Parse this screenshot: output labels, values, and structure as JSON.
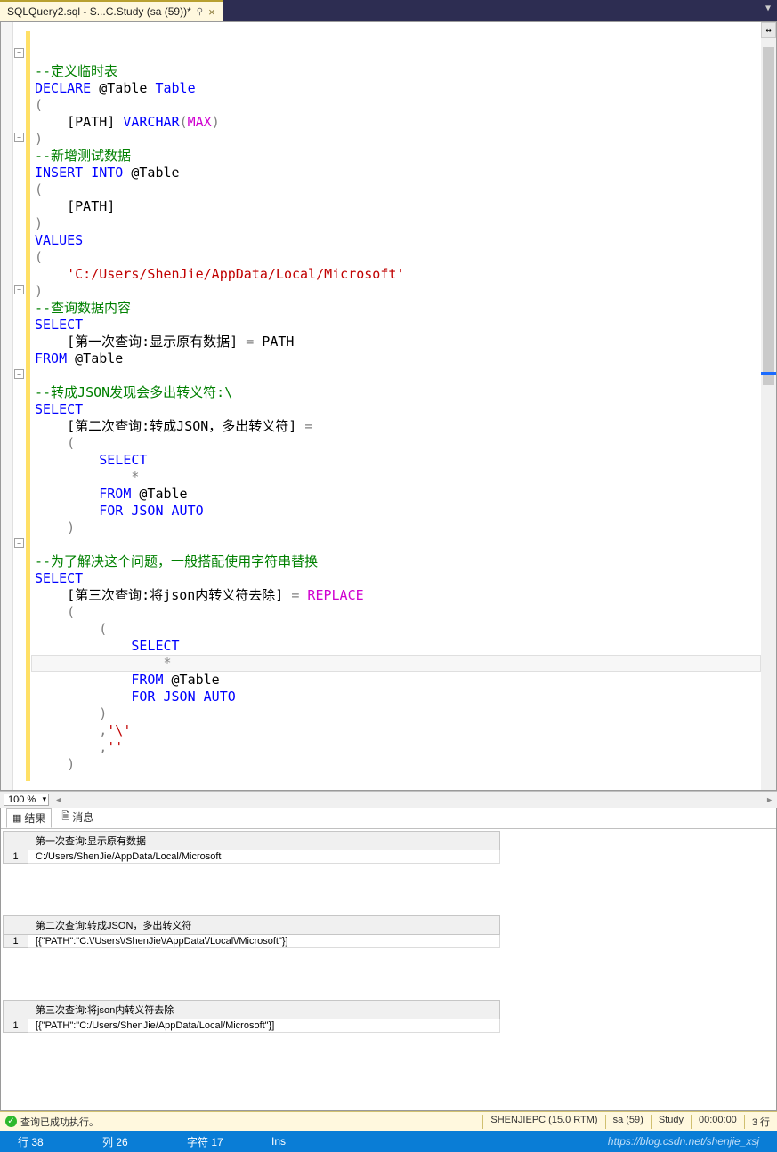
{
  "tab": {
    "title": "SQLQuery2.sql - S...C.Study (sa (59))*",
    "pin": "⚲",
    "close": "×"
  },
  "zoom": "100 %",
  "code": {
    "l1": "--定义临时表",
    "l2a": "DECLARE",
    "l2b": " @Table ",
    "l2c": "Table",
    "l3": "(",
    "l4a": "    [PATH] ",
    "l4b": "VARCHAR",
    "l4c": "(",
    "l4d": "MAX",
    "l4e": ")",
    "l5": ")",
    "l6": "--新增测试数据",
    "l7a": "INSERT",
    "l7b": " INTO",
    "l7c": " @Table",
    "l8": "(",
    "l9": "    [PATH]",
    "l10": ")",
    "l11": "VALUES",
    "l12": "(",
    "l13": "    'C:/Users/ShenJie/AppData/Local/Microsoft'",
    "l14": ")",
    "l15": "--查询数据内容",
    "l16": "SELECT",
    "l17a": "    [第一次查询:显示原有数据] ",
    "l17b": "=",
    "l17c": " PATH",
    "l18a": "FROM",
    "l18b": " @Table",
    "l19": " ",
    "l20": "--转成JSON发现会多出转义符:\\",
    "l21": "SELECT",
    "l22a": "    [第二次查询:转成JSON，多出转义符] ",
    "l22b": "=",
    "l23": "    (",
    "l24": "        SELECT",
    "l25a": "            ",
    "l25b": "*",
    "l26a": "        FROM",
    "l26b": " @Table",
    "l27a": "        FOR",
    "l27b": " JSON",
    "l27c": " AUTO",
    "l28": "    )",
    "l29": " ",
    "l30": "--为了解决这个问题，一般搭配使用字符串替换",
    "l31": "SELECT",
    "l32a": "    [第三次查询:将json内转义符去除] ",
    "l32b": "=",
    "l32c": " REPLACE",
    "l33": "    (",
    "l34": "        (",
    "l35": "            SELECT",
    "l36a": "                ",
    "l36b": "*",
    "l37a": "            FROM",
    "l37b": " @Table",
    "l38a": "            FOR",
    "l38b": " JSON",
    "l38c": " AUTO",
    "l39": "        )",
    "l40a": "        ",
    "l40b": ",",
    "l40c": "'\\'",
    "l41a": "        ",
    "l41b": ",",
    "l41c": "''",
    "l42": "    )"
  },
  "resultTabs": {
    "results": "结果",
    "messages": "消息"
  },
  "grids": {
    "g1": {
      "header": "第一次查询:显示原有数据",
      "row": "1",
      "val": "C:/Users/ShenJie/AppData/Local/Microsoft"
    },
    "g2": {
      "header": "第二次查询:转成JSON，多出转义符",
      "row": "1",
      "val": "[{\"PATH\":\"C:\\/Users\\/ShenJie\\/AppData\\/Local\\/Microsoft\"}]"
    },
    "g3": {
      "header": "第三次查询:将json内转义符去除",
      "row": "1",
      "val": "[{\"PATH\":\"C:/Users/ShenJie/AppData/Local/Microsoft\"}]"
    }
  },
  "status1": {
    "msg": "查询已成功执行。",
    "server": "SHENJIEPC (15.0 RTM)",
    "user": "sa (59)",
    "db": "Study",
    "time": "00:00:00",
    "rows": "3 行"
  },
  "status2": {
    "line": "行 38",
    "col": "列 26",
    "char": "字符 17",
    "ins": "Ins",
    "url": "https://blog.csdn.net/shenjie_xsj"
  }
}
